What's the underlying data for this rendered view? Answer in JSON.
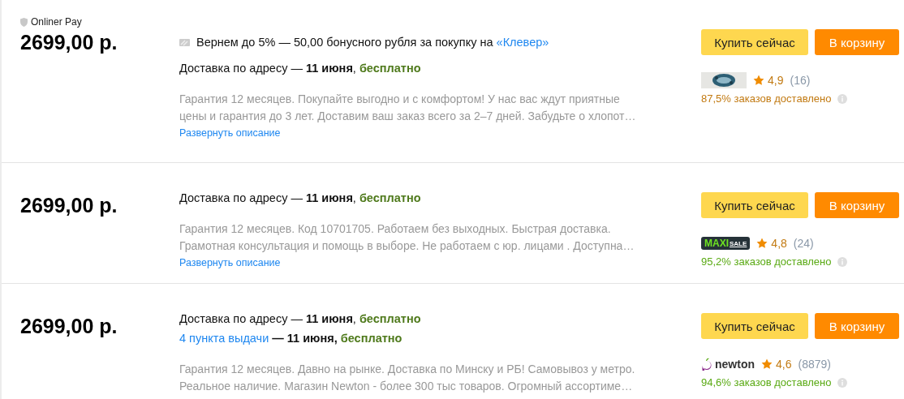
{
  "offers": [
    {
      "pay_badge": "Onliner Pay",
      "price": "2699,00 р.",
      "cashback": {
        "text": "Вернем до 5% — 50,00 бонусного рубля за покупку на ",
        "link": "«Клевер»"
      },
      "delivery": [
        {
          "kind": "address",
          "method": "Доставка по адресу",
          "rest": "— **11 июня**,",
          "cost": "бесплатно"
        }
      ],
      "description_lines": [
        "Гарантия 12 месяцев. Покупайте выгодно и с комфортом! У нас вас ждут приятные",
        "цены и гарантия до 3 лет. Доставим ваш заказ всего за 2–7 дней. Забудьте о хлопот…"
      ],
      "expand": "Развернуть описание",
      "buy": "Купить сейчас",
      "cart": "В корзину",
      "seller": {
        "kind": "emblem",
        "rating": "4,9",
        "reviews": "(16)",
        "delivered": "87,5% заказов доставлено",
        "color": "#c27a12"
      }
    },
    {
      "price": "2699,00 р.",
      "delivery": [
        {
          "kind": "address",
          "method": "Доставка по адресу",
          "rest": "— **11 июня**,",
          "cost": "бесплатно"
        }
      ],
      "description_lines": [
        "Гарантия 12 месяцев. Код 10701705. Работаем без выходных. Быстрая доставка.",
        "Грамотная консультация и помощь в выборе. Не работаем с юр. лицами . Доступна…"
      ],
      "expand": "Развернуть описание",
      "buy": "Купить сейчас",
      "cart": "В корзину",
      "seller": {
        "kind": "wordmark",
        "logo_text": [
          "MAXI",
          "SALE"
        ],
        "rating": "4,8",
        "reviews": "(24)",
        "delivered": "95,2% заказов доставлено",
        "color": "#5aaa14"
      }
    },
    {
      "price": "2699,00 р.",
      "delivery": [
        {
          "kind": "address",
          "method": "Доставка по адресу",
          "rest": "— **11 июня**,",
          "cost": "бесплатно"
        },
        {
          "kind": "pickup",
          "method": "4 пункта выдачи",
          "rest": "**— 11 июня,**",
          "cost": "бесплатно"
        }
      ],
      "description_lines": [
        "Гарантия 12 месяцев. Давно на рынке. Доставка по Минску и РБ! Самовывоз у метро.",
        "Реальное наличие. Магазин Newton - более 300 тыс товаров. Огромный ассортиме…"
      ],
      "buy": "Купить сейчас",
      "cart": "В корзину",
      "seller": {
        "kind": "fruit-wordmark",
        "logo_text": [
          "newton"
        ],
        "rating": "4,6",
        "reviews": "(8879)",
        "delivered": "94,6% заказов доставлено",
        "color": "#5aaa14"
      }
    }
  ]
}
